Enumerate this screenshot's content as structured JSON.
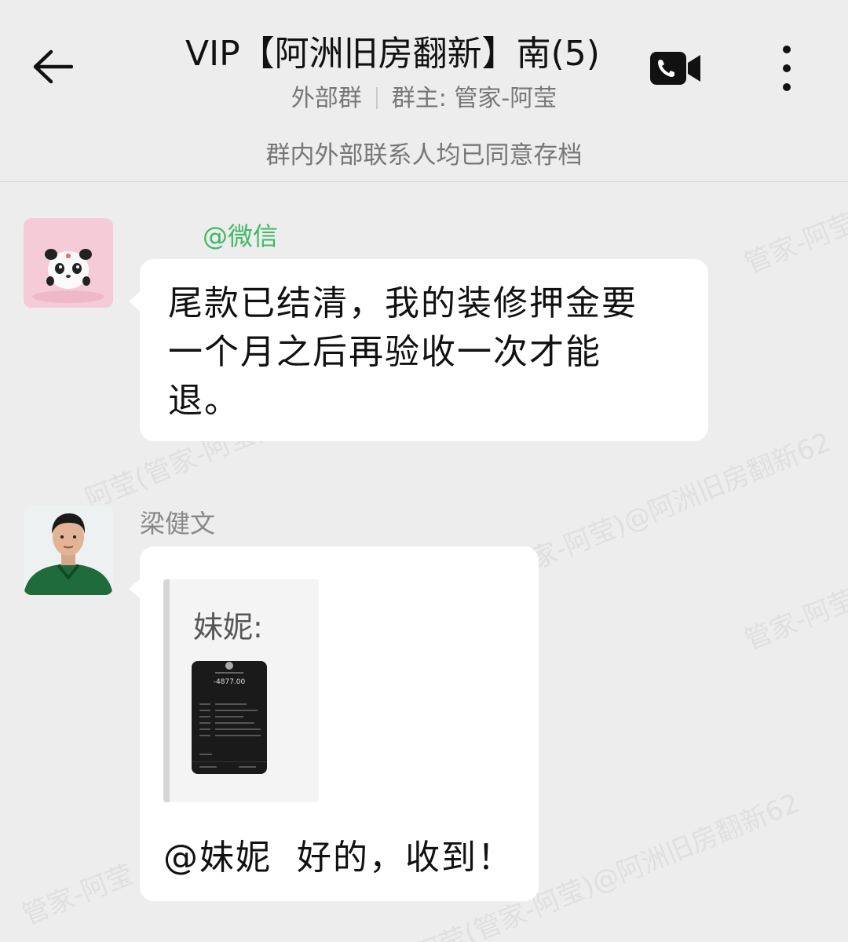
{
  "header": {
    "title": "VIP【阿洲旧房翻新】南(5)",
    "group_type": "外部群",
    "owner": "群主: 管家-阿莹",
    "notice": "群内外部联系人均已同意存档"
  },
  "watermark": {
    "text_1": "管家-阿莹",
    "text_2": "阿莹(管家-阿莹)@阿洲旧房翻新62"
  },
  "messages": [
    {
      "sender": "@微信",
      "text_line1": "尾款已结清，我的装修押金要",
      "text_line2": "一个月之后再验收一次才能",
      "text_line3": "退。"
    },
    {
      "sender": "梁健文",
      "quote_name": "妹妮:",
      "quote_amount": "-4877.00",
      "reply": "@妹妮  好的，收到！"
    }
  ],
  "colors": {
    "background": "#ededed",
    "bubble": "#ffffff",
    "sender_green": "#3fb864"
  }
}
